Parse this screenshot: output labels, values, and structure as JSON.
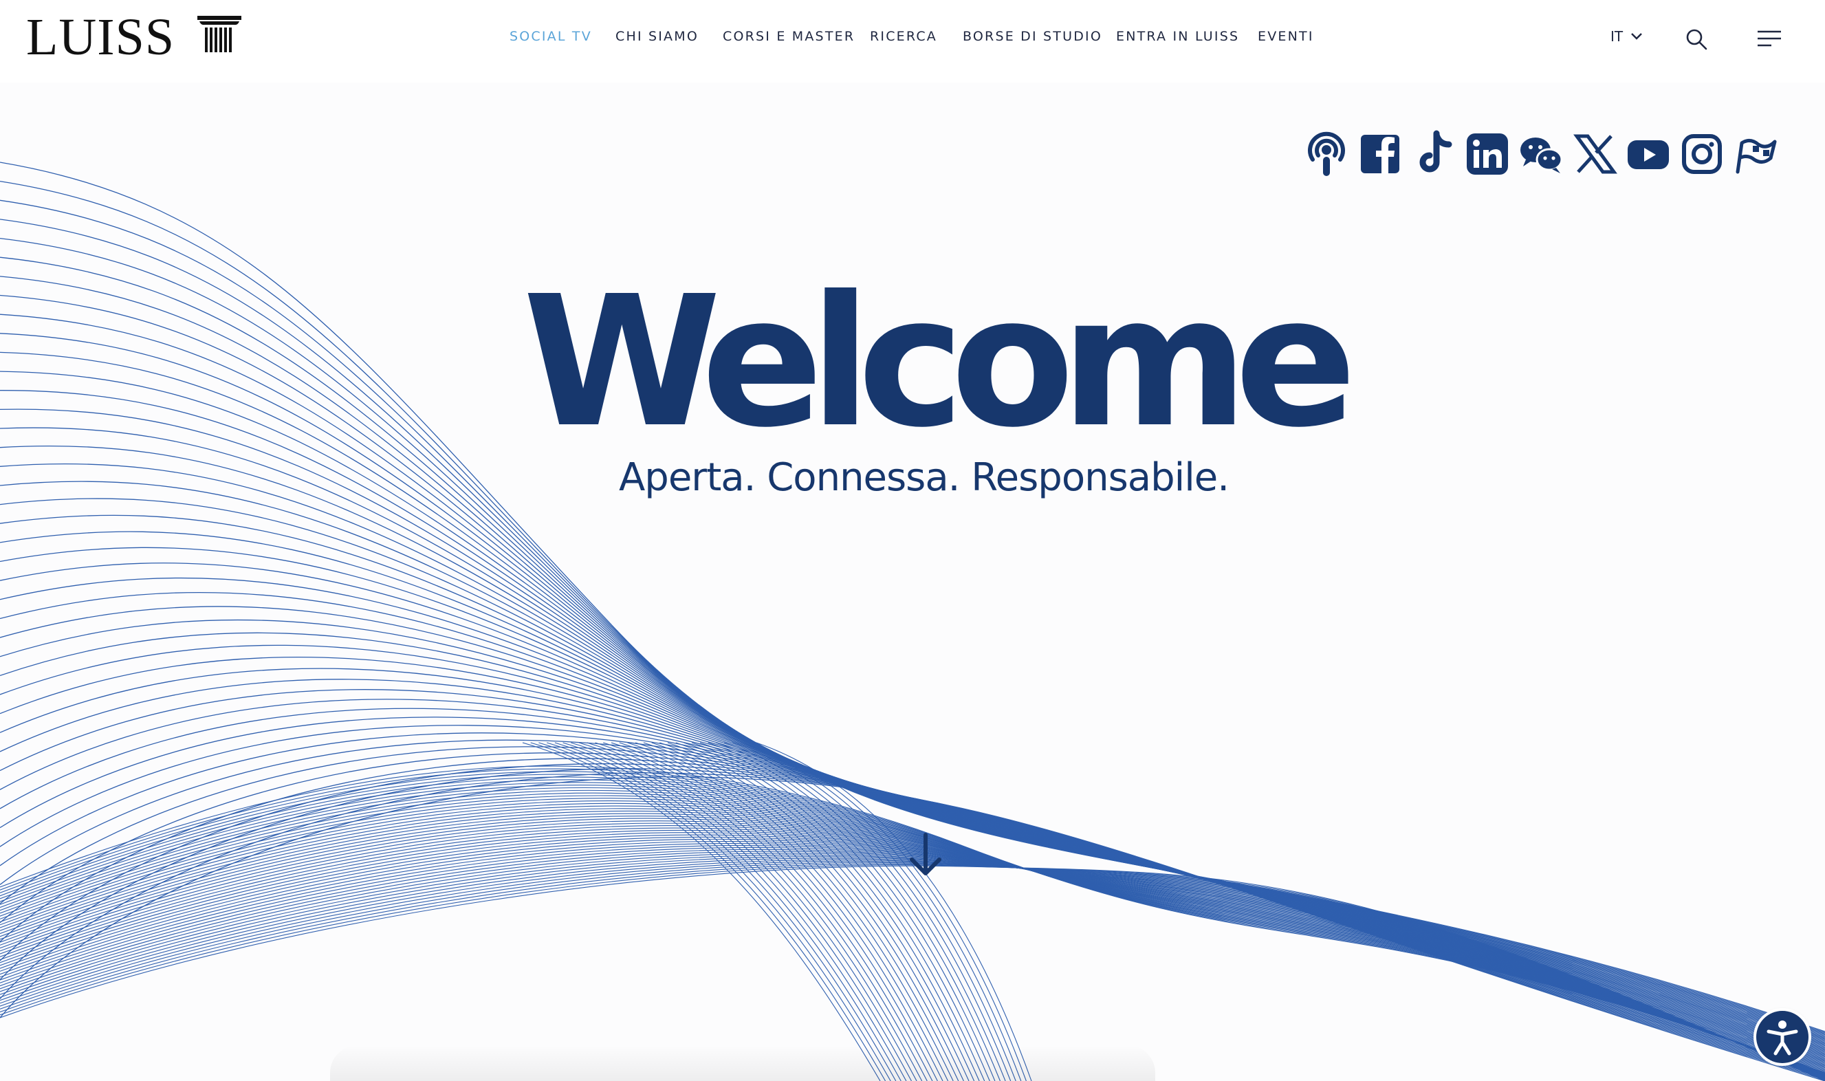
{
  "brand": {
    "name": "LUISS"
  },
  "nav": {
    "items": [
      {
        "label": "SOCIAL TV",
        "active": true
      },
      {
        "label": "CHI SIAMO",
        "active": false
      },
      {
        "label": "CORSI E MASTER",
        "active": false
      },
      {
        "label": "RICERCA",
        "active": false
      },
      {
        "label": "BORSE DI STUDIO",
        "active": false
      },
      {
        "label": "ENTRA IN LUISS",
        "active": false
      },
      {
        "label": "EVENTI",
        "active": false
      }
    ],
    "language": "IT",
    "icons": [
      "chevron-down-icon",
      "search-icon",
      "menu-icon"
    ]
  },
  "social": {
    "icons": [
      "podcast-icon",
      "facebook-icon",
      "tiktok-icon",
      "linkedin-icon",
      "wechat-icon",
      "x-icon",
      "youtube-icon",
      "instagram-icon",
      "flag-icon"
    ]
  },
  "hero": {
    "title": "Welcome",
    "subtitle": "Aperta. Connessa. Responsabile.",
    "scroll_icon": "arrow-down-icon"
  },
  "accessibility": {
    "icon": "accessibility-icon"
  },
  "colors": {
    "brand_navy": "#17376d",
    "nav_active": "#5aa4d8",
    "wave_lines": "#2f5fae",
    "background": "#fcfcfd"
  }
}
